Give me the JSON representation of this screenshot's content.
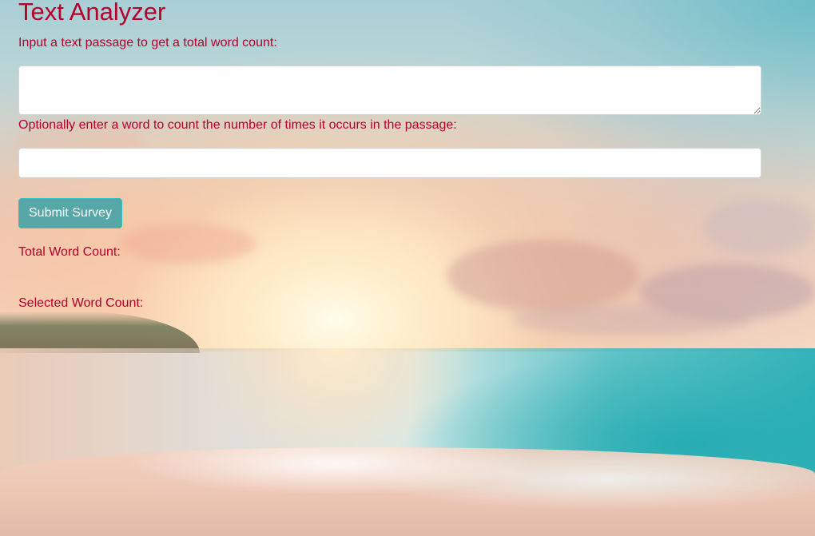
{
  "page": {
    "title": "Text Analyzer"
  },
  "form": {
    "passage_label": "Input a text passage to get a total word count:",
    "passage_value": "",
    "word_label": "Optionally enter a word to count the number of times it occurs in the passage:",
    "word_value": "",
    "submit_label": "Submit Survey"
  },
  "results": {
    "total_label": "Total Word Count:",
    "total_value": "",
    "selected_label": "Selected Word Count:",
    "selected_value": ""
  },
  "colors": {
    "heading_text": "#b5002b",
    "submit_button": "#57a7a9",
    "submit_border": "#36c0c3"
  }
}
